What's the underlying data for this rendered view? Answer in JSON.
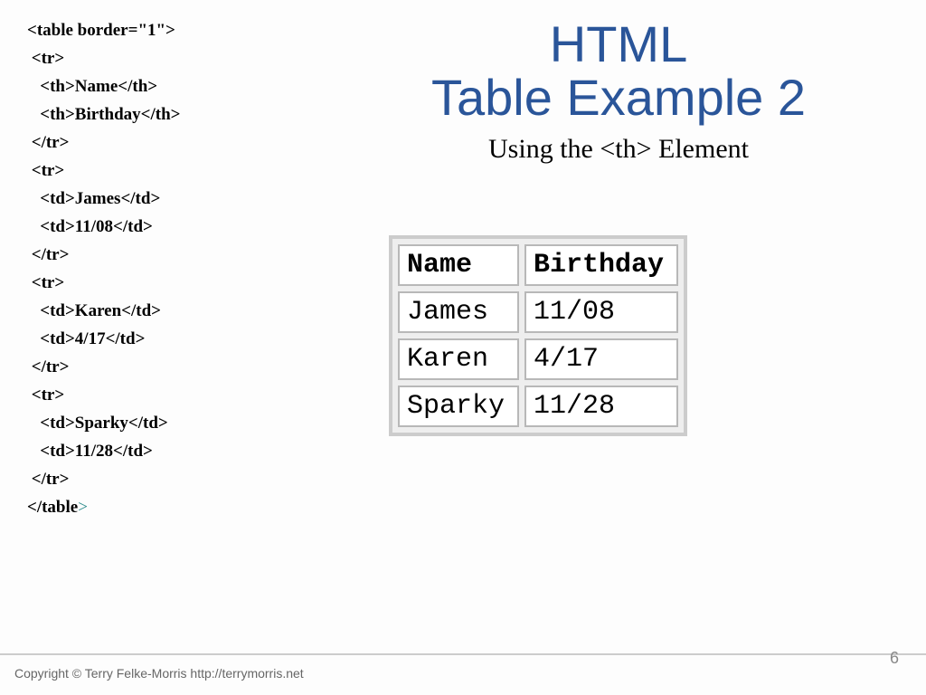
{
  "title": {
    "line1": "HTML",
    "line2": "Table Example 2"
  },
  "subtitle": "Using the <th> Element",
  "code_lines": [
    "<table border=\"1\">",
    " <tr>",
    "   <th>Name</th>",
    "   <th>Birthday</th>",
    " </tr>",
    " <tr>",
    "   <td>James</td>",
    "   <td>11/08</td>",
    " </tr>",
    " <tr>",
    "   <td>Karen</td>",
    "   <td>4/17</td>",
    " </tr>",
    " <tr>",
    "   <td>Sparky</td>",
    "   <td>11/28</td>",
    " </tr>",
    "</table>"
  ],
  "table": {
    "headers": [
      "Name",
      "Birthday"
    ],
    "rows": [
      [
        "James",
        "11/08"
      ],
      [
        "Karen",
        "4/17"
      ],
      [
        "Sparky",
        "11/28"
      ]
    ]
  },
  "footer": "Copyright © Terry Felke-Morris http://terrymorris.net",
  "page_number": "6"
}
